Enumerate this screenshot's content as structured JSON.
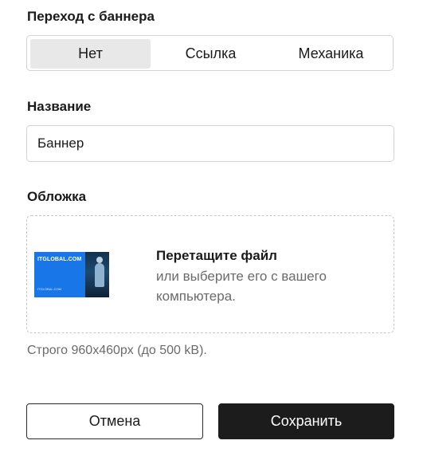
{
  "transition": {
    "label": "Переход с баннера",
    "options": [
      "Нет",
      "Ссылка",
      "Механика"
    ],
    "selected": "Нет"
  },
  "name": {
    "label": "Название",
    "value": "Баннер"
  },
  "cover": {
    "label": "Обложка",
    "thumbnail_title": "ITGLOBAL.COM",
    "thumbnail_subtitle": "ITGLOBAL.COM",
    "drop_title": "Перетащите файл",
    "drop_text": "или выберите его с вашего компьютера.",
    "hint": "Строго 960x460px (до 500 kB)."
  },
  "actions": {
    "cancel_label": "Отмена",
    "save_label": "Сохранить"
  },
  "colors": {
    "primary_button": "#1c1c1c",
    "segment_active": "#e8e8e8",
    "thumbnail_brand": "#1976e8"
  }
}
